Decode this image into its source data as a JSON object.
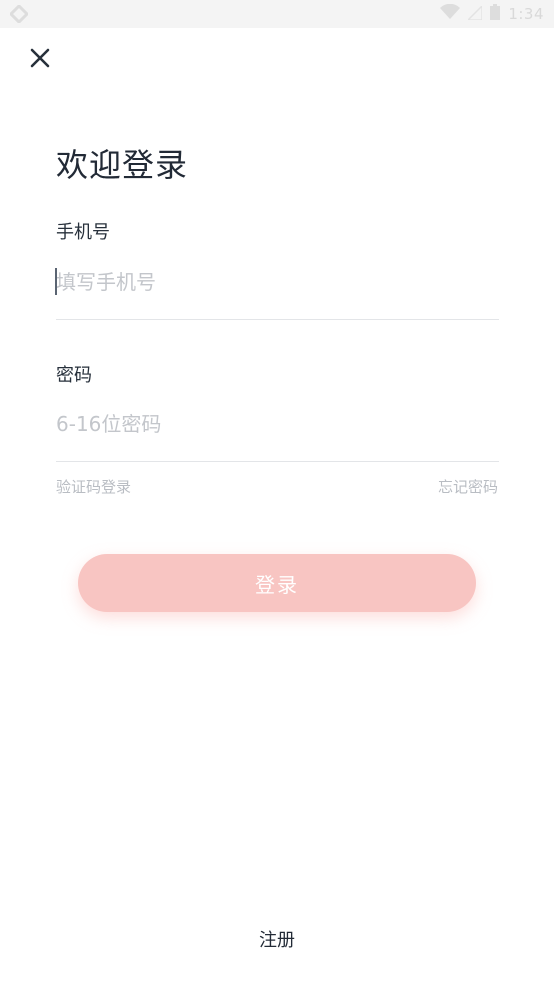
{
  "status_bar": {
    "time": "1:34",
    "icons": [
      "app-icon",
      "wifi-icon",
      "signal-icon",
      "battery-icon"
    ]
  },
  "header": {
    "close_icon": "close-icon",
    "title": "欢迎登录"
  },
  "phone_field": {
    "label": "手机号",
    "value": "",
    "placeholder": "填写手机号"
  },
  "password_field": {
    "label": "密码",
    "value": "",
    "placeholder": "6-16位密码"
  },
  "links": {
    "sms_login": "验证码登录",
    "forgot_password": "忘记密码"
  },
  "login_button": {
    "label": "登录"
  },
  "register": {
    "label": "注册"
  },
  "colors": {
    "button_bg": "#f8c5c2",
    "title_text": "#222a36",
    "placeholder": "#c3c6cb",
    "link_text": "#b9bdc3"
  }
}
